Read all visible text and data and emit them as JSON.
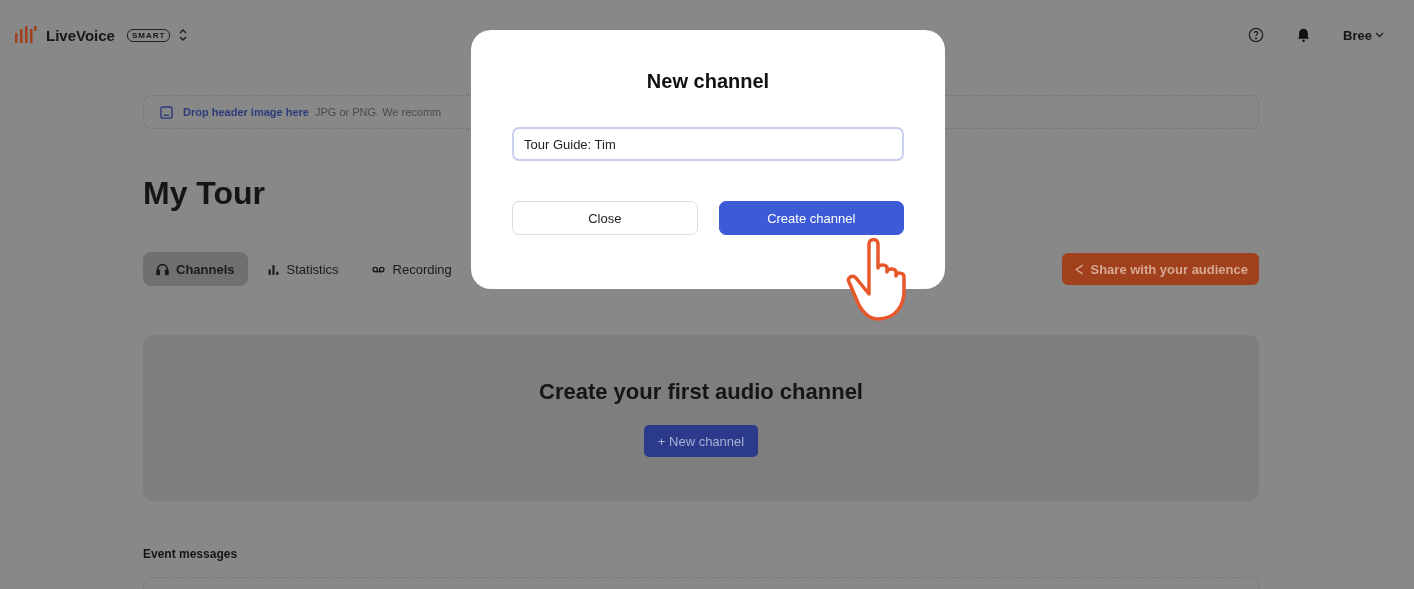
{
  "header": {
    "brand": "LiveVoice",
    "plan_badge": "SMART",
    "user": "Bree"
  },
  "header_drop": {
    "link": "Drop header image here",
    "hint": "JPG or PNG. We recomm"
  },
  "title": "My Tour",
  "tabs": [
    {
      "label": "Channels",
      "selected": true
    },
    {
      "label": "Statistics",
      "selected": false
    },
    {
      "label": "Recording",
      "selected": false
    }
  ],
  "share_button": "Share with your audience",
  "empty_state": {
    "heading": "Create your first audio channel",
    "button": "+ New channel"
  },
  "event_messages": {
    "label": "Event messages"
  },
  "dialog": {
    "title": "New channel",
    "name_field": {
      "value": "Tour Guide: Tim"
    },
    "buttons": [
      {
        "label": "Close",
        "kind": "secondary"
      },
      {
        "label": "Create channel",
        "kind": "primary"
      }
    ]
  }
}
